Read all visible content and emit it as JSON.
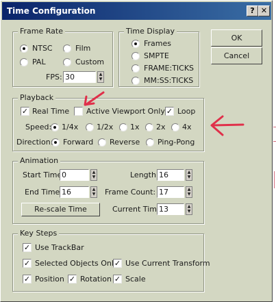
{
  "window": {
    "title": "Time Configuration",
    "help_label": "?",
    "close_label": "✕"
  },
  "buttons": {
    "ok": "OK",
    "cancel": "Cancel"
  },
  "frame_rate": {
    "title": "Frame Rate",
    "ntsc": "NTSC",
    "film": "Film",
    "pal": "PAL",
    "custom": "Custom",
    "selected": "NTSC",
    "fps_label": "FPS:",
    "fps_value": "30"
  },
  "time_display": {
    "title": "Time Display",
    "frames": "Frames",
    "smpte": "SMPTE",
    "frame_ticks": "FRAME:TICKS",
    "mmssticks": "MM:SS:TICKS",
    "selected": "Frames"
  },
  "playback": {
    "title": "Playback",
    "real_time": "Real Time",
    "real_time_checked": true,
    "active_viewport_only": "Active Viewport Only",
    "active_viewport_only_checked": false,
    "loop": "Loop",
    "loop_checked": true,
    "speed_label": "Speed:",
    "speeds": [
      "1/4x",
      "1/2x",
      "1x",
      "2x",
      "4x"
    ],
    "speed_selected": "1/4x",
    "direction_label": "Direction:",
    "directions": [
      "Forward",
      "Reverse",
      "Ping-Pong"
    ],
    "direction_selected": "Forward"
  },
  "animation": {
    "title": "Animation",
    "start_time_label": "Start Time:",
    "start_time_value": "0",
    "end_time_label": "End Time:",
    "end_time_value": "16",
    "length_label": "Length:",
    "length_value": "16",
    "frame_count_label": "Frame Count:",
    "frame_count_value": "17",
    "current_time_label": "Current Time:",
    "current_time_value": "13",
    "rescale_label": "Re-scale Time"
  },
  "key_steps": {
    "title": "Key Steps",
    "use_trackbar": "Use TrackBar",
    "use_trackbar_checked": true,
    "selected_objects_only": "Selected Objects Only",
    "selected_objects_only_checked": true,
    "use_current_transform": "Use Current Transform",
    "use_current_transform_checked": true,
    "position": "Position",
    "position_checked": true,
    "rotation": "Rotation",
    "rotation_checked": true,
    "scale": "Scale",
    "scale_checked": true
  },
  "annotation_color": "#e0304a",
  "check_glyph": "✓",
  "spin_up": "▲",
  "spin_down": "▼"
}
